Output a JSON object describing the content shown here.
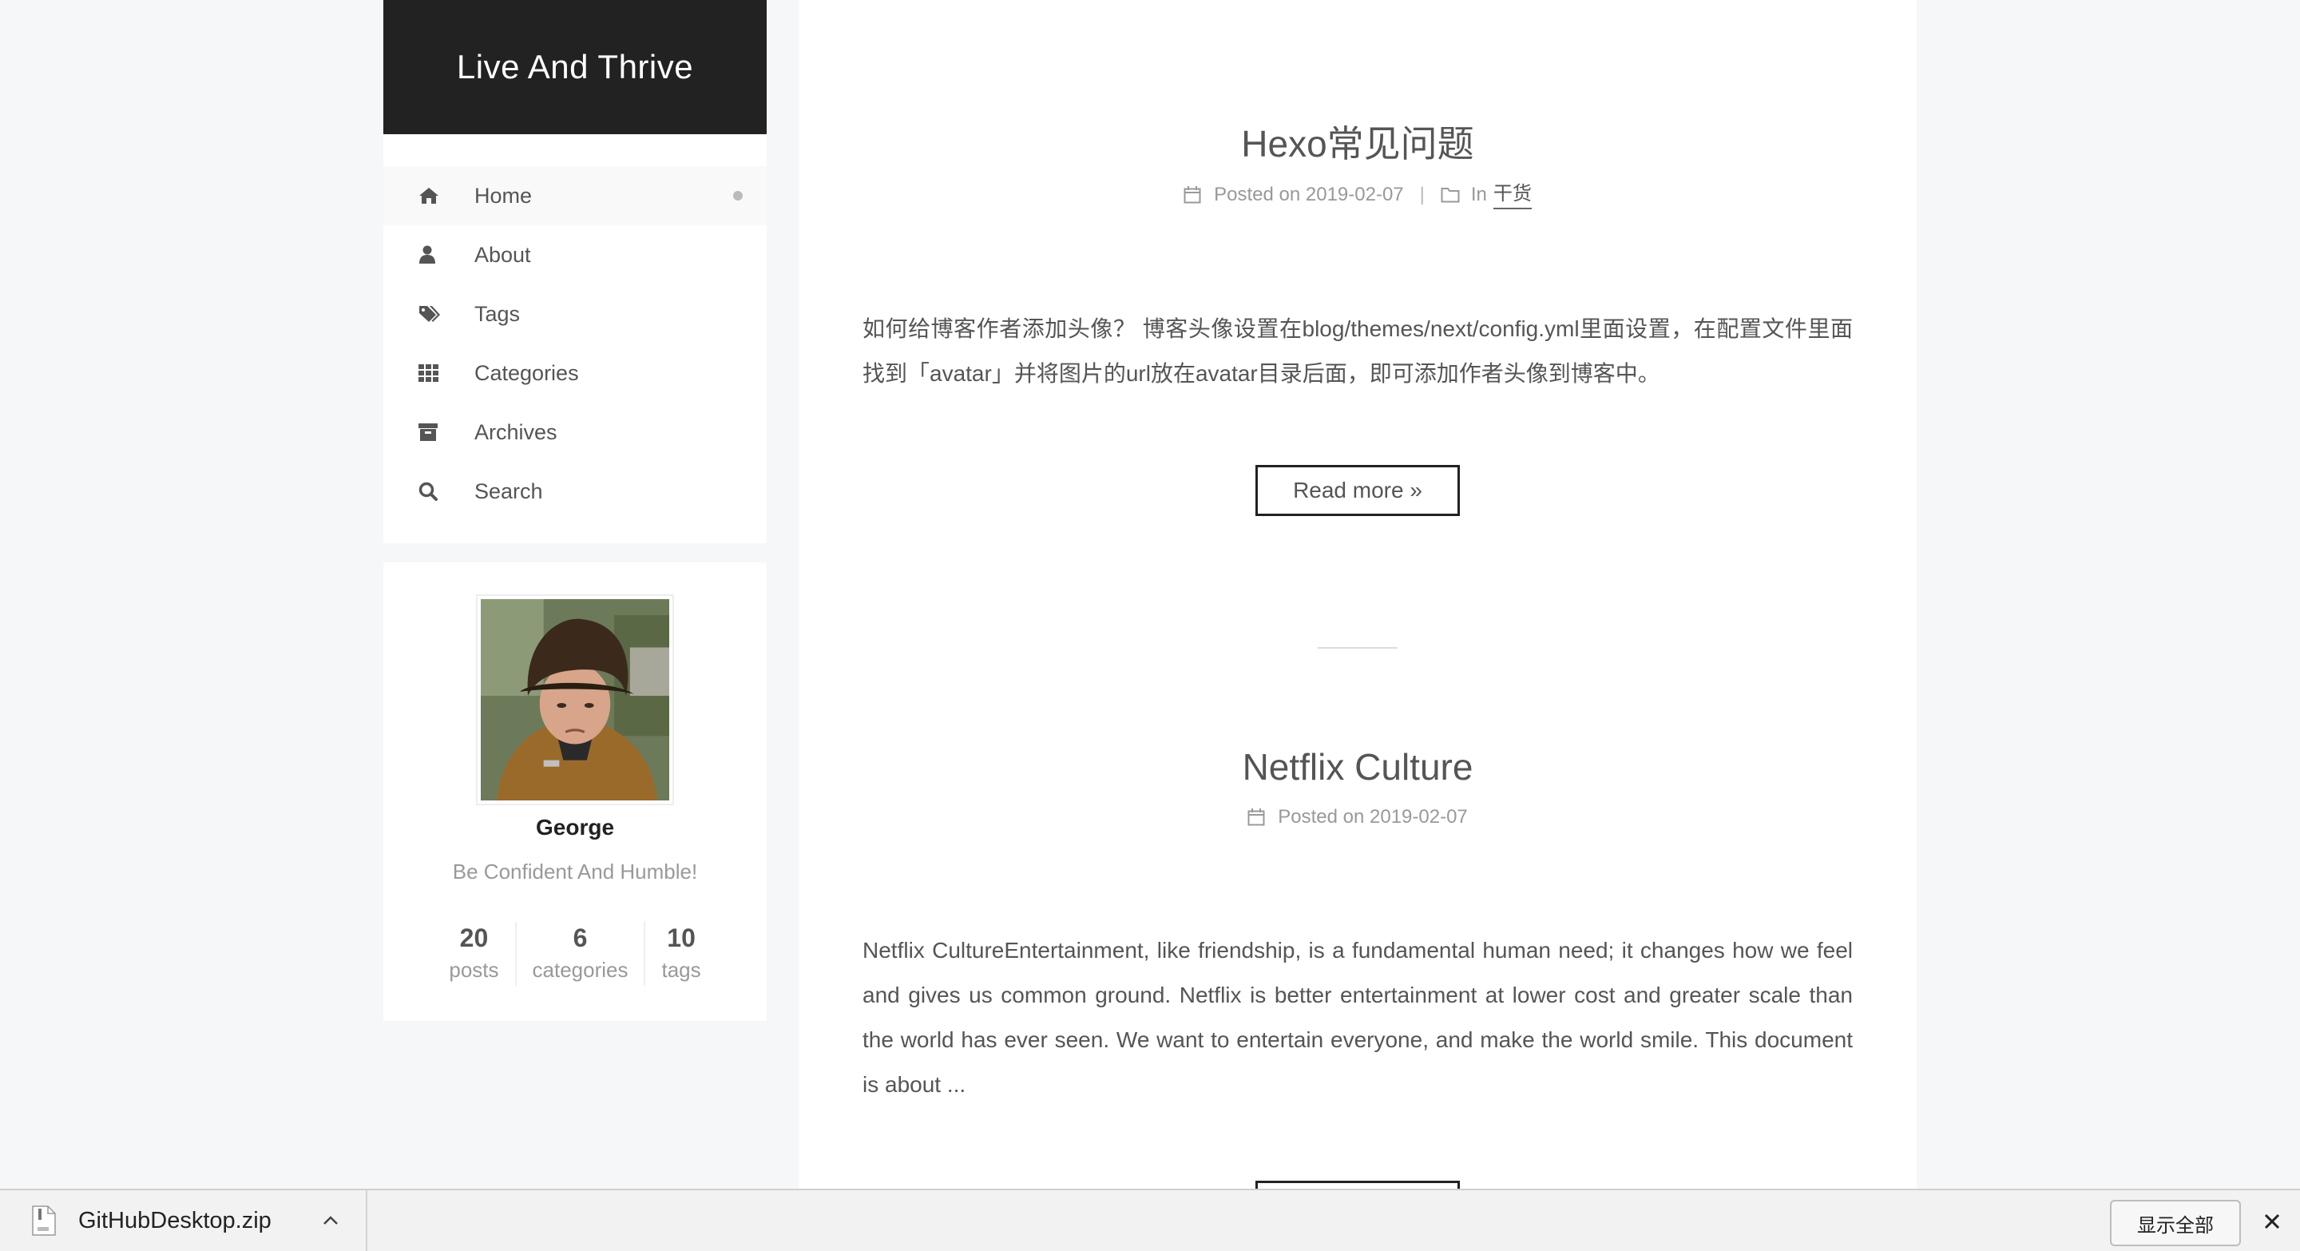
{
  "site": {
    "title": "Live And Thrive"
  },
  "menu": {
    "items": [
      {
        "label": "Home",
        "icon": "home-icon",
        "active": true
      },
      {
        "label": "About",
        "icon": "user-icon"
      },
      {
        "label": "Tags",
        "icon": "tags-icon"
      },
      {
        "label": "Categories",
        "icon": "grid-icon"
      },
      {
        "label": "Archives",
        "icon": "archive-icon"
      },
      {
        "label": "Search",
        "icon": "search-icon"
      }
    ]
  },
  "author": {
    "name": "George",
    "motto": "Be Confident And Humble!",
    "stats": [
      {
        "count": "20",
        "label": "posts"
      },
      {
        "count": "6",
        "label": "categories"
      },
      {
        "count": "10",
        "label": "tags"
      }
    ]
  },
  "posts": [
    {
      "title": "Hexo常见问题",
      "posted_prefix": "Posted on",
      "date": "2019-02-07",
      "in_prefix": "In",
      "category": "干货",
      "excerpt": "如何给博客作者添加头像？ 博客头像设置在blog/themes/next/config.yml里面设置，在配置文件里面找到「avatar」并将图片的url放在avatar目录后面，即可添加作者头像到博客中。",
      "read_more": "Read more »"
    },
    {
      "title": "Netflix Culture",
      "posted_prefix": "Posted on",
      "date": "2019-02-07",
      "excerpt": "Netflix CultureEntertainment, like friendship, is a fundamental human need; it changes how we feel and gives us common ground. Netflix is better entertainment at lower cost and greater scale than the world has ever seen. We want to entertain everyone, and make the world smile. This document is about ..."
    }
  ],
  "download_bar": {
    "file_name": "GitHubDesktop.zip",
    "show_all": "显示全部"
  },
  "colors": {
    "header_bg": "#222222",
    "page_bg": "#f5f7f9",
    "text": "#555555"
  }
}
